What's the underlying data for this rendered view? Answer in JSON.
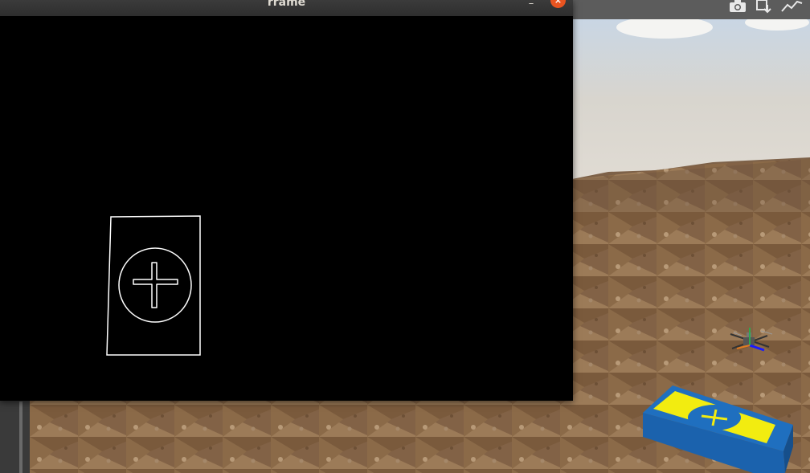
{
  "window": {
    "title": "rrame",
    "minimize_label": "–",
    "close_label": "×"
  },
  "toolbar": {
    "icons": [
      "camera-icon",
      "download-icon",
      "chart-line-icon"
    ]
  },
  "frame": {
    "description_icon": "edge-detected-landing-pad"
  },
  "colors": {
    "titlebar": "#2e2e2e",
    "close": "#e95420",
    "pad_blue": "#1f6fbf",
    "pad_yellow": "#f2ec10",
    "ground": "#8a6b4b",
    "sky": "#dcd8d0"
  }
}
